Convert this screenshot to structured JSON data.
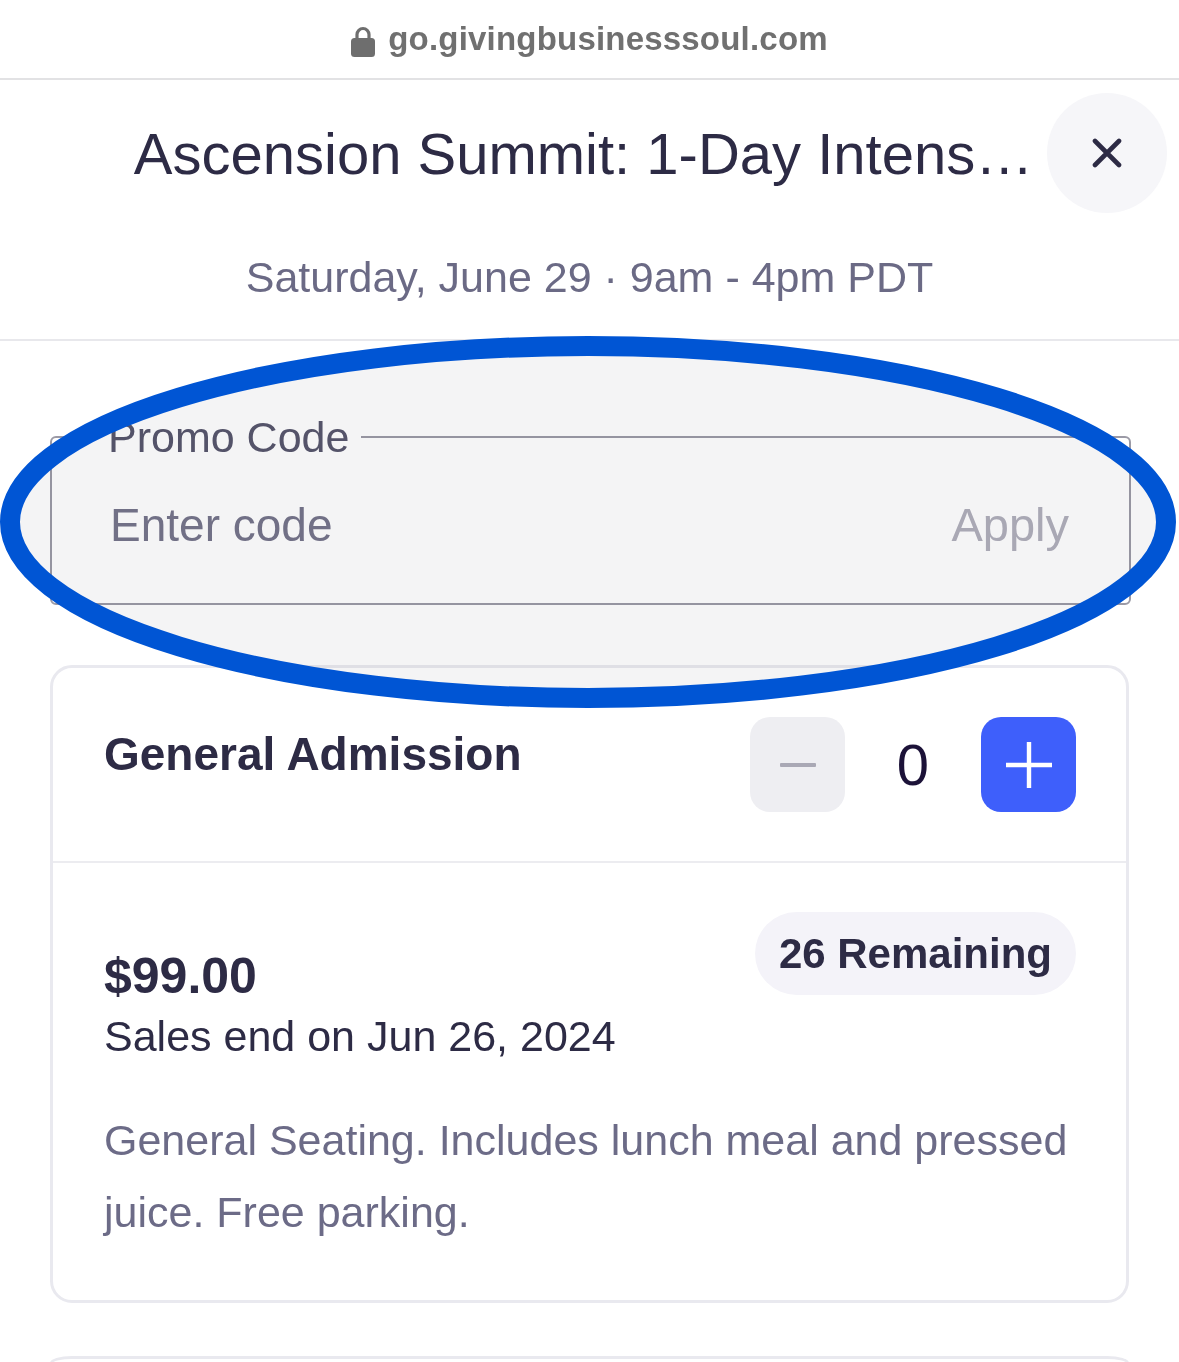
{
  "browser_bar": {
    "url": "go.givingbusinesssoul.com",
    "secure": true
  },
  "event": {
    "title": "Ascension Summit: 1-Day Intens…",
    "schedule": "Saturday, June 29 · 9am - 4pm PDT"
  },
  "promo_code": {
    "label": "Promo Code",
    "placeholder": "Enter code",
    "action": {
      "label": "Apply",
      "disabled": true
    }
  },
  "tickets": [
    {
      "name": "General Admission",
      "quantity": "0",
      "decrease_disabled": true,
      "price": "$99.00",
      "sales_end": "Sales end on Jun 26, 2024",
      "remaining": "26 Remaining",
      "description": "General Seating. Includes lunch meal and pressed juice. Free parking."
    }
  ],
  "more_tickets_below": true,
  "annotations": [
    {
      "kind": "ellipse"
    }
  ]
}
